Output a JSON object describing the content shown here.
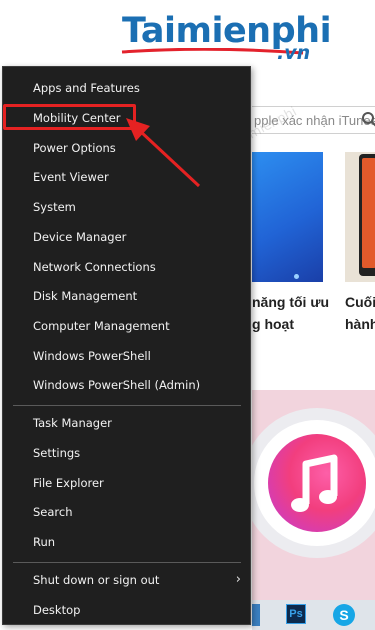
{
  "logo": {
    "main": "Taimienphi",
    "sub": ".vn"
  },
  "background": {
    "search_text": "pple xác nhận iTunes tr",
    "cards": [
      {
        "title_line1": "năng tối ưu",
        "title_line2": "g hoạt"
      },
      {
        "title_line1": "Cuối",
        "title_line2": "hành"
      }
    ],
    "taskbar": {
      "ps_label": "Ps",
      "skype_label": "S"
    }
  },
  "watermark": "Taimienphi",
  "menu": {
    "items": [
      {
        "label": "Apps and Features"
      },
      {
        "label": "Mobility Center"
      },
      {
        "label": "Power Options"
      },
      {
        "label": "Event Viewer"
      },
      {
        "label": "System"
      },
      {
        "label": "Device Manager"
      },
      {
        "label": "Network Connections"
      },
      {
        "label": "Disk Management"
      },
      {
        "label": "Computer Management"
      },
      {
        "label": "Windows PowerShell"
      },
      {
        "label": "Windows PowerShell (Admin)"
      },
      {
        "label": "Task Manager"
      },
      {
        "label": "Settings"
      },
      {
        "label": "File Explorer"
      },
      {
        "label": "Search"
      },
      {
        "label": "Run"
      },
      {
        "label": "Shut down or sign out"
      },
      {
        "label": "Desktop"
      }
    ],
    "submenu_arrow": "›"
  },
  "colors": {
    "menu_bg": "#1f1f1f",
    "menu_text": "#f2f2f2",
    "highlight_red": "#e52222",
    "logo_blue": "#1b6fb3"
  },
  "icons": [
    "search-icon",
    "chevron-right-icon",
    "photoshop-icon",
    "skype-icon",
    "itunes-icon",
    "red-arrow"
  ]
}
